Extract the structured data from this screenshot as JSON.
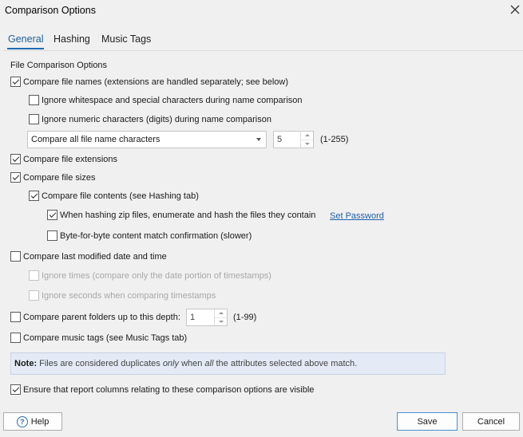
{
  "window": {
    "title": "Comparison Options"
  },
  "tabs": [
    {
      "label": "General"
    },
    {
      "label": "Hashing"
    },
    {
      "label": "Music Tags"
    }
  ],
  "general": {
    "section_title": "File Comparison Options",
    "options": {
      "compare_names": {
        "label": "Compare file names (extensions are handled separately; see below)",
        "checked": true
      },
      "ignore_whitespace": {
        "label": "Ignore whitespace and special characters during name comparison",
        "checked": false
      },
      "ignore_numeric": {
        "label": "Ignore numeric characters (digits) during name comparison",
        "checked": false
      },
      "compare_extensions": {
        "label": "Compare file extensions",
        "checked": true
      },
      "compare_sizes": {
        "label": "Compare file sizes",
        "checked": true
      },
      "compare_contents": {
        "label": "Compare file contents (see Hashing tab)",
        "checked": true
      },
      "hash_zip": {
        "label": "When hashing zip files, enumerate and hash the files they contain",
        "checked": true
      },
      "byte_for_byte": {
        "label": "Byte-for-byte content match confirmation (slower)",
        "checked": false
      },
      "compare_modified": {
        "label": "Compare last modified date and time",
        "checked": false
      },
      "ignore_times": {
        "label": "Ignore times (compare only the date portion of timestamps)",
        "checked": false,
        "disabled": true
      },
      "ignore_seconds": {
        "label": "Ignore seconds when comparing timestamps",
        "checked": false,
        "disabled": true
      },
      "compare_parent": {
        "label": "Compare parent folders up to this depth:",
        "checked": false
      },
      "compare_music_tags": {
        "label": "Compare music tags (see Music Tags tab)",
        "checked": false
      },
      "ensure_columns": {
        "label": "Ensure that report columns relating to these comparison options are visible",
        "checked": true
      }
    },
    "name_chars": {
      "selected": "Compare all file name characters",
      "count": "5",
      "range": "(1-255)"
    },
    "parent_depth": {
      "value": "1",
      "range": "(1-99)"
    },
    "set_password_link": "Set Password",
    "note": {
      "label": "Note:",
      "part1": "Files are considered duplicates",
      "em1": "only",
      "part2": "when",
      "em2": "all",
      "part3": "the attributes selected above match."
    }
  },
  "footer": {
    "help_label": "Help",
    "help_icon_glyph": "?",
    "save_label": "Save",
    "cancel_label": "Cancel"
  }
}
